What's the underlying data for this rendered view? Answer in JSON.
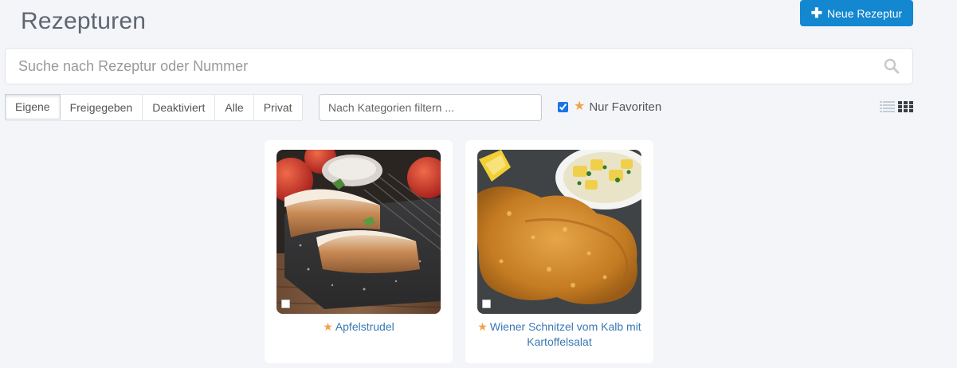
{
  "header": {
    "title": "Rezepturen",
    "new_button_label": "Neue Rezeptur"
  },
  "search": {
    "placeholder": "Suche nach Rezeptur oder Nummer",
    "value": ""
  },
  "tabs": [
    {
      "label": "Eigene",
      "active": true
    },
    {
      "label": "Freigegeben",
      "active": false
    },
    {
      "label": "Deaktiviert",
      "active": false
    },
    {
      "label": "Alle",
      "active": false
    },
    {
      "label": "Privat",
      "active": false
    }
  ],
  "category_filter": {
    "placeholder": "Nach Kategorien filtern ..."
  },
  "favorites_filter": {
    "checked": true,
    "label": "Nur Favoriten"
  },
  "view_modes": [
    "list-view-icon",
    "grid-view-icon"
  ],
  "recipes": [
    {
      "name": "Apfelstrudel",
      "favorite": true,
      "image": "apple-strudel-photo"
    },
    {
      "name": "Wiener Schnitzel vom Kalb mit Kartoffelsalat",
      "favorite": true,
      "image": "wiener-schnitzel-photo"
    }
  ],
  "colors": {
    "accent": "#1387cf",
    "star": "#f0a24a",
    "link": "#3978b4",
    "background": "#f3f5f9"
  }
}
